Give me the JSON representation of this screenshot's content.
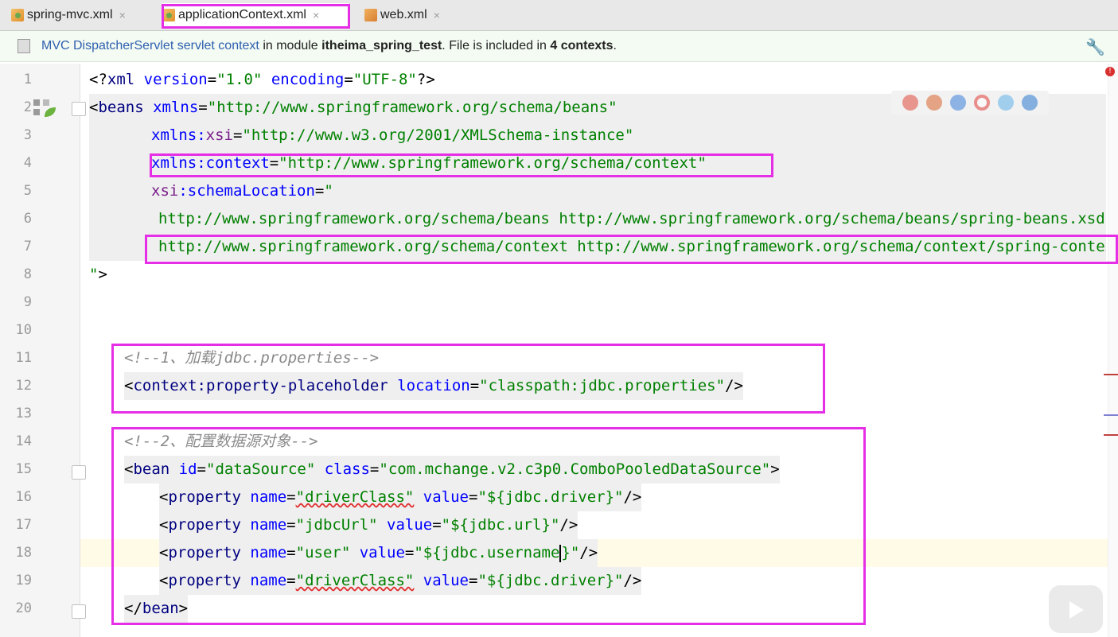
{
  "tabs": [
    {
      "label": "spring-mvc.xml",
      "close": "×",
      "icon": "xml-file-icon",
      "active": false
    },
    {
      "label": "applicationContext.xml",
      "close": "×",
      "icon": "xml-file-icon",
      "active": true
    },
    {
      "label": "web.xml",
      "close": "×",
      "icon": "web-xml-file-icon",
      "active": false
    }
  ],
  "infobar": {
    "link": "MVC DispatcherServlet servlet context",
    "text1": " in module ",
    "module": "itheima_spring_test",
    "text2": ". File is included in ",
    "count": "4 contexts",
    "text3": "."
  },
  "line_numbers": [
    "1",
    "2",
    "3",
    "4",
    "5",
    "6",
    "7",
    "8",
    "9",
    "10",
    "11",
    "12",
    "13",
    "14",
    "15",
    "16",
    "17",
    "18",
    "19",
    "20"
  ],
  "code": {
    "l1": {
      "a": "<?",
      "b": "xml",
      "c": " version",
      "d": "=",
      "e": "\"1.0\"",
      "f": " encoding",
      "g": "=",
      "h": "\"UTF-8\"",
      "i": "?>"
    },
    "l2": {
      "a": "<",
      "b": "beans",
      "c": " xmlns",
      "d": "=",
      "e": "\"http://www.springframework.org/schema/beans\""
    },
    "l3": {
      "c": "xmlns:",
      "c2": "xsi",
      "d": "=",
      "e": "\"http://www.w3.org/2001/XMLSchema-instance\""
    },
    "l4": {
      "c": "xmlns:",
      "c2": "context",
      "d": "=",
      "e": "\"http://www.springframework.org/schema/context\""
    },
    "l5": {
      "c": "xsi",
      "c2": ":schemaLocation",
      "d": "=",
      "e": "\""
    },
    "l6": {
      "e": "http://www.springframework.org/schema/beans http://www.springframework.org/schema/beans/spring-beans.xsd"
    },
    "l7": {
      "e": "http://www.springframework.org/schema/context http://www.springframework.org/schema/context/spring-context.xsd"
    },
    "l8": {
      "e": "\"",
      "i": ">"
    },
    "l11": {
      "comment": "<!--1、加载jdbc.properties-->"
    },
    "l12": {
      "a": "<",
      "b": "context",
      "b2": ":property-placeholder",
      "c": " location",
      "d": "=",
      "e": "\"classpath:jdbc.properties\"",
      "i": "/>"
    },
    "l14": {
      "comment": "<!--2、配置数据源对象-->"
    },
    "l15": {
      "a": "<",
      "b": "bean",
      "c": " id",
      "d": "=",
      "e": "\"dataSource\"",
      "c2": " class",
      "d2": "=",
      "e2": "\"com.mchange.v2.c3p0.ComboPooledDataSource\"",
      "i": ">"
    },
    "l16": {
      "a": "<",
      "b": "property",
      "c": " name",
      "d": "=",
      "e": "\"driverClass\"",
      "c2": " value",
      "d2": "=",
      "e2": "\"${jdbc.driver}\"",
      "i": "/>"
    },
    "l17": {
      "a": "<",
      "b": "property",
      "c": " name",
      "d": "=",
      "e": "\"jdbcUrl\"",
      "c2": " value",
      "d2": "=",
      "e2": "\"${jdbc.url}\"",
      "i": "/>"
    },
    "l18": {
      "a": "<",
      "b": "property",
      "c": " name",
      "d": "=",
      "e": "\"user\"",
      "c2": " value",
      "d2": "=",
      "e2a": "\"${jdbc.username",
      "e2b": "}\"",
      "i": "/>"
    },
    "l19": {
      "a": "<",
      "b": "property",
      "c": " name",
      "d": "=",
      "e": "\"driverClass\"",
      "c2": " value",
      "d2": "=",
      "e2": "\"${jdbc.driver}\"",
      "i": "/>"
    },
    "l20": {
      "a": "</",
      "b": "bean",
      "i": ">"
    }
  },
  "colors": {
    "highlight_box": "#e52ee5",
    "tag": "#000080",
    "attr": "#0000ff",
    "value": "#008000",
    "comment": "#8a8a8a"
  },
  "icons": [
    "wrench-icon",
    "error-icon",
    "spring-bean-gutter-icon",
    "chrome-icon",
    "firefox-icon",
    "safari-icon",
    "opera-icon",
    "ie-icon",
    "edge-icon",
    "play-icon"
  ]
}
